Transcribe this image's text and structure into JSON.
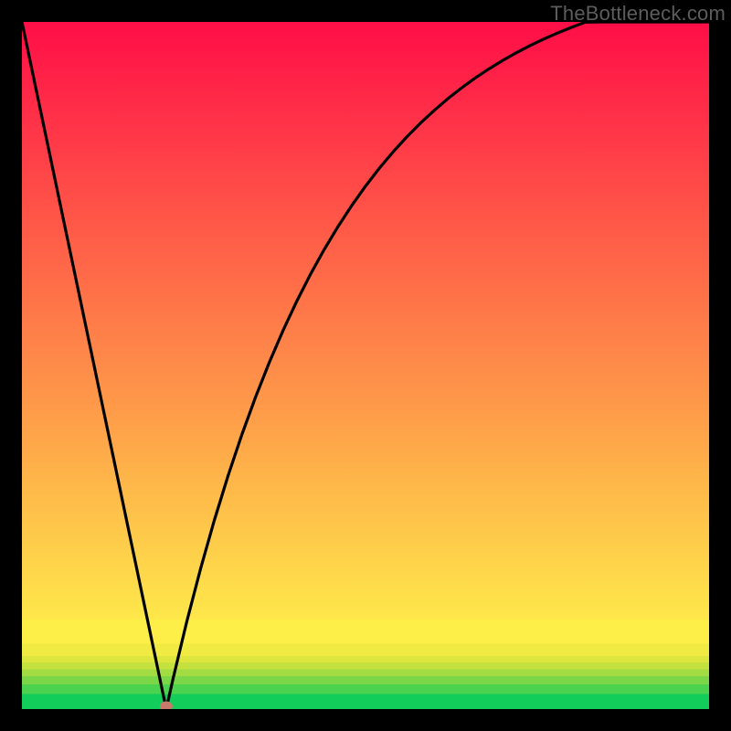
{
  "watermark": "TheBottleneck.com",
  "chart_data": {
    "type": "line",
    "title": "",
    "xlabel": "",
    "ylabel": "",
    "xlim": [
      0,
      100
    ],
    "ylim": [
      0,
      100
    ],
    "grid": false,
    "legend": false,
    "x": [
      0,
      2,
      4,
      6,
      8,
      10,
      12,
      14,
      16,
      18,
      20,
      21,
      22,
      24,
      26,
      28,
      30,
      32,
      34,
      36,
      38,
      40,
      42,
      44,
      46,
      48,
      50,
      52,
      54,
      56,
      58,
      60,
      62,
      64,
      66,
      68,
      70,
      72,
      74,
      76,
      78,
      80,
      82,
      84,
      86,
      88,
      90,
      92,
      94,
      96,
      98,
      100
    ],
    "y": [
      100,
      90.47,
      80.95,
      71.42,
      61.9,
      52.38,
      42.85,
      33.33,
      23.8,
      14.28,
      4.76,
      0,
      4.45,
      12.77,
      20.43,
      27.48,
      33.96,
      39.92,
      45.4,
      50.45,
      55.09,
      59.36,
      63.29,
      66.9,
      70.22,
      73.28,
      76.1,
      78.69,
      81.07,
      83.26,
      85.28,
      87.13,
      88.84,
      90.41,
      91.86,
      93.19,
      94.41,
      95.54,
      96.58,
      97.53,
      98.41,
      99.22,
      99.97,
      100.65,
      101.29,
      101.87,
      102.4,
      102.9,
      103.36,
      103.78,
      104.16,
      104.52
    ],
    "marker": {
      "x": 21,
      "y": 0
    },
    "gradient_bands": [
      {
        "y_from": 0,
        "y_to": 2.2,
        "color": "#12cd5a"
      },
      {
        "y_from": 2.2,
        "y_to": 3.6,
        "color": "#4bd24f"
      },
      {
        "y_from": 3.6,
        "y_to": 4.8,
        "color": "#7cd748"
      },
      {
        "y_from": 4.8,
        "y_to": 5.8,
        "color": "#a3dc42"
      },
      {
        "y_from": 5.8,
        "y_to": 6.8,
        "color": "#c4e13f"
      },
      {
        "y_from": 6.8,
        "y_to": 7.7,
        "color": "#dde63f"
      },
      {
        "y_from": 7.7,
        "y_to": 9.5,
        "color": "#f1ea42"
      },
      {
        "y_from": 9.5,
        "y_to": 13,
        "color": "#feee48"
      },
      {
        "y_from": 13,
        "y_to": 100,
        "type": "linear",
        "from_color": "#fee84a",
        "to_color": "#ff0e47"
      }
    ]
  }
}
